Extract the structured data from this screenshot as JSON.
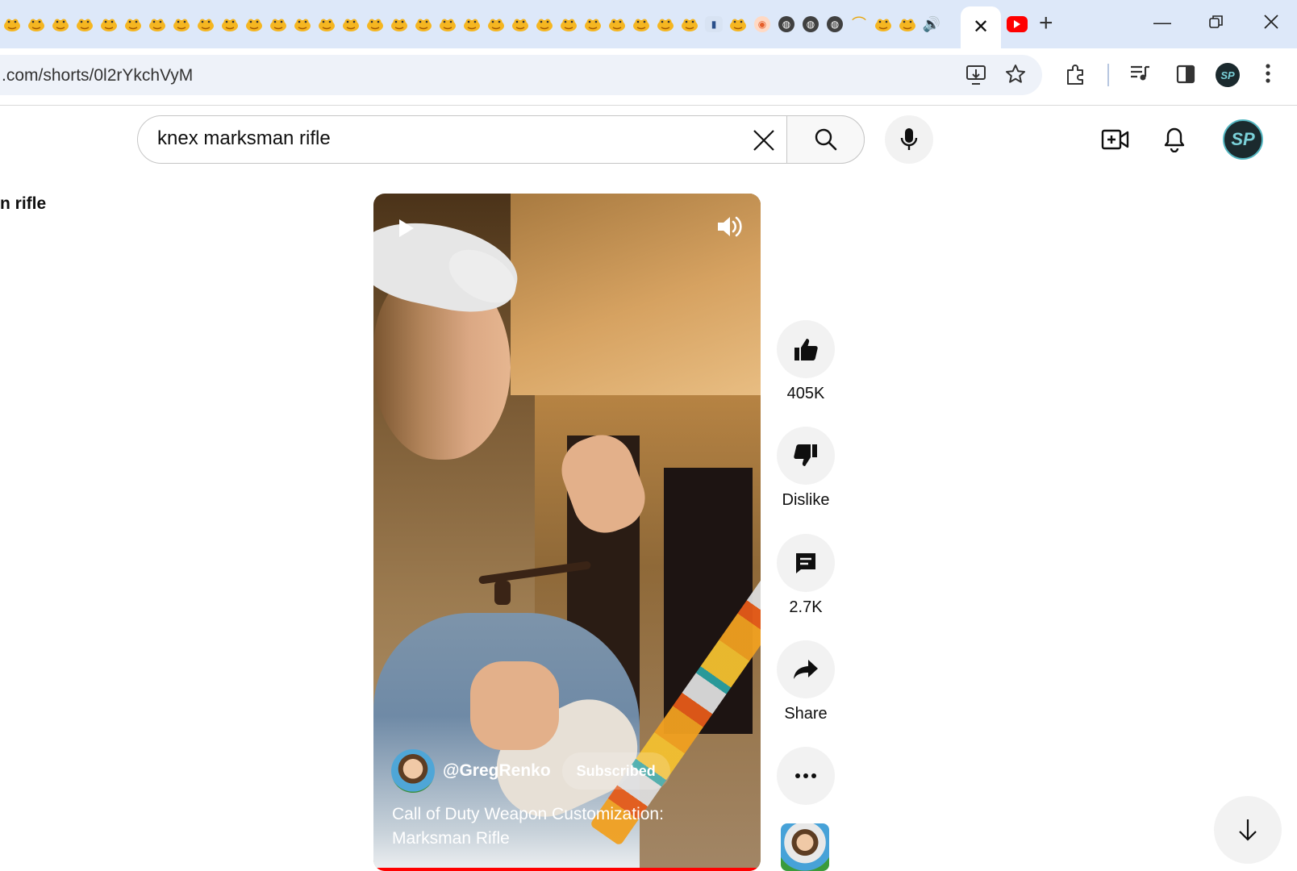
{
  "browser": {
    "tab_favicons": [
      "yellow",
      "yellow",
      "yellow",
      "yellow",
      "yellow",
      "yellow",
      "yellow",
      "yellow",
      "yellow",
      "yellow",
      "yellow",
      "yellow",
      "yellow",
      "yellow",
      "yellow",
      "yellow",
      "yellow",
      "yellow",
      "yellow",
      "yellow",
      "yellow",
      "yellow",
      "yellow",
      "yellow",
      "yellow",
      "yellow",
      "yellow",
      "yellow",
      "yellow",
      "blue",
      "yellow",
      "orange",
      "globe",
      "globe",
      "globe",
      "swoosh",
      "yellow",
      "yellow",
      "audio"
    ],
    "active_tab_close": "✕",
    "new_tab": "+",
    "url": ".com/shorts/0l2rYkchVyM",
    "profile_initials": "SP"
  },
  "youtube": {
    "search": {
      "value": "knex marksman rifle"
    },
    "left_partial_text": "n rifle",
    "profile_initials": "SP"
  },
  "short": {
    "channel": "@GregRenko",
    "subscribe_label": "Subscribed",
    "title": "Call of Duty Weapon Customization: Marksman Rifle",
    "progress": 1.0
  },
  "actions": {
    "like_count": "405K",
    "dislike_label": "Dislike",
    "comment_count": "2.7K",
    "share_label": "Share"
  },
  "colors": {
    "accent": "#ff0000",
    "tabstrip": "#dde8f9",
    "button_bg": "#f2f2f2"
  }
}
